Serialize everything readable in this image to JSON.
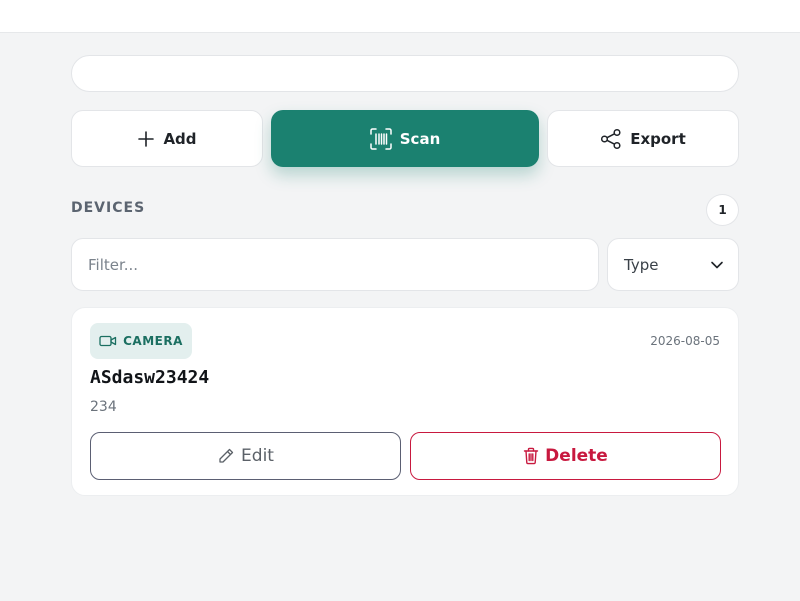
{
  "toolbar": {
    "add_label": "Add",
    "scan_label": "Scan",
    "export_label": "Export"
  },
  "devices": {
    "title": "DEVICES",
    "count": "1",
    "filter_placeholder": "Filter...",
    "type_select": "Type",
    "items": [
      {
        "type": "CAMERA",
        "date": "2026-08-05",
        "name": "ASdasw23424",
        "detail": "234",
        "edit_label": "Edit",
        "delete_label": "Delete"
      }
    ]
  },
  "colors": {
    "primary": "#1b8170",
    "danger": "#c8193f",
    "badge_bg": "#e3efee"
  },
  "icons": [
    "plus-icon",
    "barcode-scan-icon",
    "share-icon",
    "chevron-down-icon",
    "camera-icon",
    "pencil-icon",
    "trash-icon"
  ]
}
